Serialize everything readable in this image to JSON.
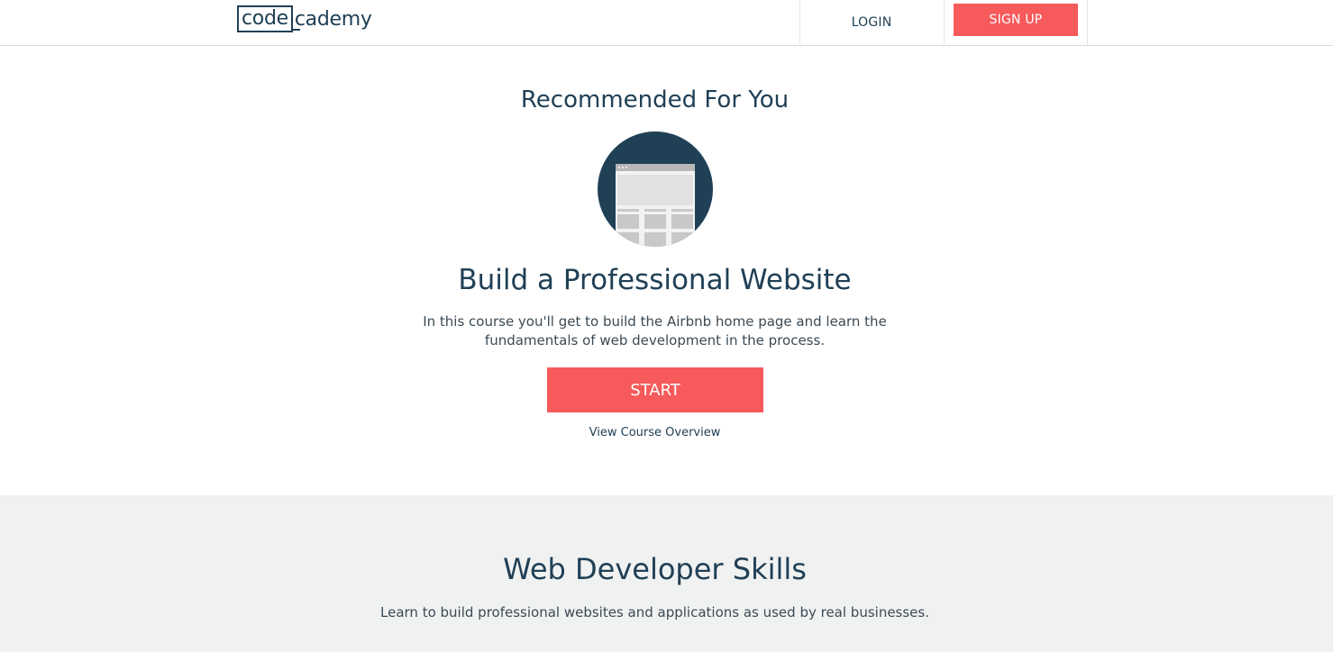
{
  "header": {
    "logo_left": "code",
    "logo_right": "cademy",
    "login_label": "LOGIN",
    "signup_label": "SIGN UP"
  },
  "recommended": {
    "heading": "Recommended For You",
    "icon": "browser-window-icon",
    "course_title": "Build a Professional Website",
    "course_description": "In this course you'll get to build the Airbnb home page and learn the fundamentals of web development in the process.",
    "start_label": "START",
    "overview_label": "View Course Overview"
  },
  "skills": {
    "heading": "Web Developer Skills",
    "description": "Learn to build professional websites and applications as used by real businesses."
  },
  "colors": {
    "brand_navy": "#204056",
    "accent_red": "#f65a5b",
    "section_gray": "#f0f1f1"
  }
}
